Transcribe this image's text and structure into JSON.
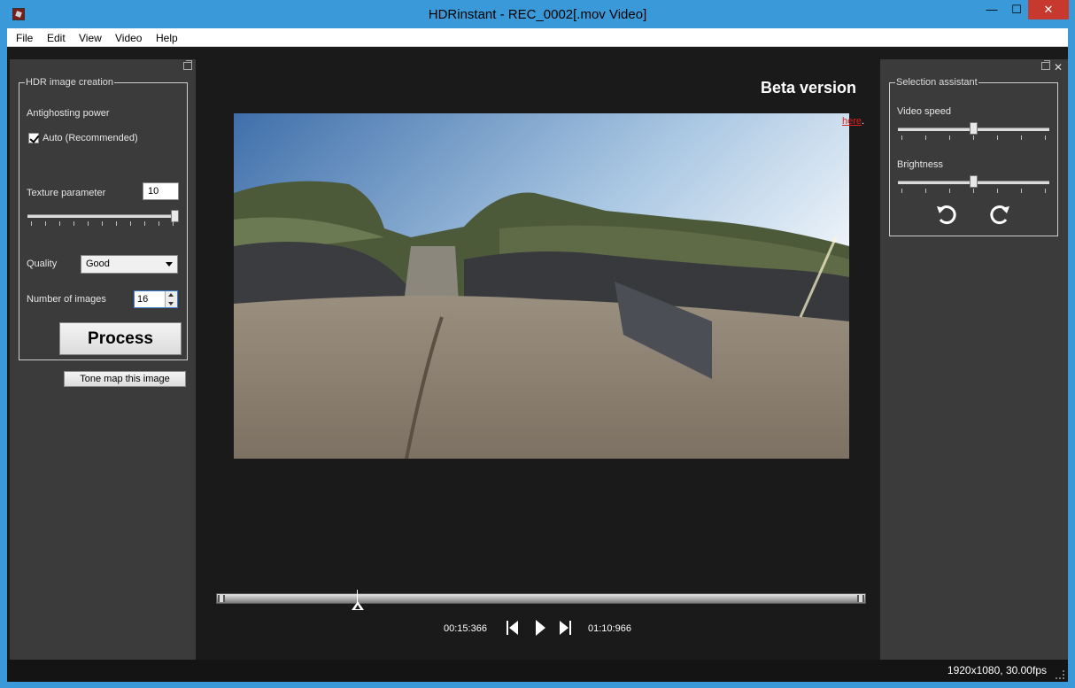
{
  "window": {
    "title": "HDRinstant  -  REC_0002[.mov Video]",
    "minimize": "—",
    "maximize": "☐",
    "close": "✕"
  },
  "menu": [
    "File",
    "Edit",
    "View",
    "Video",
    "Help"
  ],
  "left_panel": {
    "group_title": "HDR image creation",
    "antighosting_label": "Antighosting power",
    "auto_label": "Auto (Recommended)",
    "auto_checked": true,
    "texture_label": "Texture parameter",
    "texture_value": "10",
    "texture_slider_fraction": 1.0,
    "quality_label": "Quality",
    "quality_value": "Good",
    "num_images_label": "Number of images",
    "num_images_value": "16",
    "process_label": "Process",
    "tone_map_label": "Tone map this image"
  },
  "center": {
    "beta_label": "Beta version",
    "here_link": "here",
    "here_suffix": ".",
    "time_current": "00:15:366",
    "time_total": "01:10:966",
    "playhead_fraction": 0.21
  },
  "right_panel": {
    "group_title": "Selection assistant",
    "video_speed_label": "Video speed",
    "video_speed_fraction": 0.5,
    "brightness_label": "Brightness",
    "brightness_fraction": 0.5
  },
  "statusbar": {
    "text": "1920x1080,  30.00fps"
  }
}
